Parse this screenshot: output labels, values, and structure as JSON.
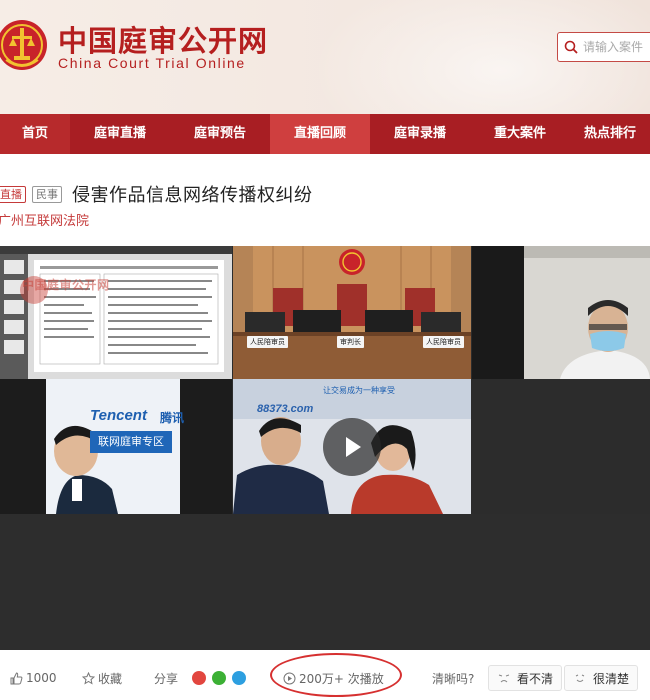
{
  "site": {
    "title": "中国庭审公开网",
    "subtitle": "China Court Trial Online",
    "search_placeholder": "请输入案件",
    "brand_color": "#a81e23"
  },
  "nav": {
    "items": [
      {
        "label": "首页"
      },
      {
        "label": "庭审直播"
      },
      {
        "label": "庭审预告"
      },
      {
        "label": "直播回顾",
        "active": true
      },
      {
        "label": "庭审录播"
      },
      {
        "label": "重大案件"
      },
      {
        "label": "热点排行"
      }
    ]
  },
  "case": {
    "tag_live": "直播",
    "tag_type": "民事",
    "title": "侵害作品信息网络传播权纠纷",
    "court": "广州互联网法院"
  },
  "video": {
    "watermark": "中国庭审公开网",
    "bench_labels": [
      "人民陪审员",
      "审判长",
      "人民陪审员"
    ],
    "brand_en": "Tencent",
    "brand_cn": "腾讯",
    "zone_text": "联网庭审专区",
    "slogan": "让交易成为一种享受",
    "site_text": "88373.com",
    "play_icon": "play-icon"
  },
  "toolbar": {
    "likes": "1000",
    "favorite": "收藏",
    "share": "分享",
    "views": "200万+ 次播放",
    "clarity_question": "清晰吗?",
    "unclear": "看不清",
    "clear": "很清楚"
  }
}
